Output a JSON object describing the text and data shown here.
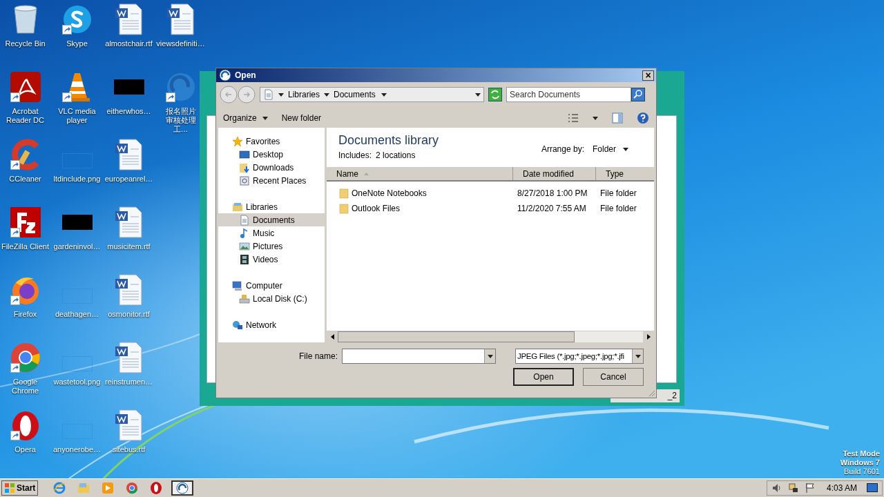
{
  "desktop": {
    "icon_columns": [
      [
        {
          "label": "Recycle Bin",
          "kind": "recycle",
          "shortcut": false
        },
        {
          "label": "Acrobat Reader DC",
          "kind": "acrobat",
          "shortcut": true
        },
        {
          "label": "CCleaner",
          "kind": "ccleaner",
          "shortcut": true
        },
        {
          "label": "FileZilla Client",
          "kind": "filezilla",
          "shortcut": true
        },
        {
          "label": "Firefox",
          "kind": "firefox",
          "shortcut": true
        },
        {
          "label": "Google Chrome",
          "kind": "chrome",
          "shortcut": true
        },
        {
          "label": "Opera",
          "kind": "opera",
          "shortcut": true
        }
      ],
      [
        {
          "label": "Skype",
          "kind": "skype",
          "shortcut": true
        },
        {
          "label": "VLC media player",
          "kind": "vlc",
          "shortcut": true
        },
        {
          "label": "ltdinclude.png",
          "kind": "blank",
          "shortcut": false
        },
        {
          "label": "gardeninvol…",
          "kind": "black",
          "shortcut": false
        },
        {
          "label": "deathagen…",
          "kind": "blank",
          "shortcut": false
        },
        {
          "label": "wastetool.png",
          "kind": "blank",
          "shortcut": false
        },
        {
          "label": "anyonerobe…",
          "kind": "blank",
          "shortcut": false
        }
      ],
      [
        {
          "label": "almostchair.rtf",
          "kind": "word",
          "shortcut": false
        },
        {
          "label": "eitherwhos…",
          "kind": "black",
          "shortcut": false
        },
        {
          "label": "europeanrel…",
          "kind": "word",
          "shortcut": false
        },
        {
          "label": "musicitem.rtf",
          "kind": "word",
          "shortcut": false
        },
        {
          "label": "osmonitor.rtf",
          "kind": "word",
          "shortcut": false
        },
        {
          "label": "reinstrumen…",
          "kind": "word",
          "shortcut": false
        },
        {
          "label": "sitebus.rtf",
          "kind": "word",
          "shortcut": false
        }
      ],
      [
        {
          "label": "viewsdefiniti…",
          "kind": "word",
          "shortcut": false
        },
        {
          "label": "报名照片审核处理工…",
          "kind": "swirl",
          "shortcut": true
        }
      ]
    ],
    "watermark_lines": [
      "Test Mode",
      "Windows 7",
      "Build 7601"
    ]
  },
  "background_window": {
    "text": "_2"
  },
  "dialog": {
    "title": "Open",
    "close": "×",
    "breadcrumbs": [
      "Libraries",
      "Documents"
    ],
    "search": {
      "placeholder": "Search Documents"
    },
    "toolbar": [
      "Organize",
      "New folder"
    ],
    "nav": [
      {
        "label": "Favorites",
        "kind": "star",
        "selected": false,
        "children": [
          {
            "label": "Desktop",
            "kind": "desktop",
            "selected": false
          },
          {
            "label": "Downloads",
            "kind": "downloads",
            "selected": false
          },
          {
            "label": "Recent Places",
            "kind": "recent",
            "selected": false
          }
        ]
      },
      {
        "label": "Libraries",
        "kind": "library",
        "selected": false,
        "children": [
          {
            "label": "Documents",
            "kind": "documents",
            "selected": true
          },
          {
            "label": "Music",
            "kind": "music",
            "selected": false
          },
          {
            "label": "Pictures",
            "kind": "pictures",
            "selected": false
          },
          {
            "label": "Videos",
            "kind": "videos",
            "selected": false
          }
        ]
      },
      {
        "label": "Computer",
        "kind": "computer",
        "selected": false,
        "children": [
          {
            "label": "Local Disk (C:)",
            "kind": "disk",
            "selected": false
          }
        ]
      },
      {
        "label": "Network",
        "kind": "network",
        "selected": false
      }
    ],
    "library_title": "Documents library",
    "includes_label": "Includes:",
    "includes_value": "2 locations",
    "arrange_label": "Arrange by:",
    "arrange_value": "Folder",
    "columns": [
      "Name",
      "Date modified",
      "Type"
    ],
    "rows": [
      {
        "name": "OneNote Notebooks",
        "date": "8/27/2018 1:00 PM",
        "type": "File folder"
      },
      {
        "name": "Outlook Files",
        "date": "11/2/2020 7:55 AM",
        "type": "File folder"
      }
    ],
    "file_name_label": "File name:",
    "filter": "JPEG Files (*.jpg;*.jpeg;*.jpg;*.jfi",
    "buttons": [
      "Open",
      "Cancel"
    ]
  },
  "taskbar": {
    "start": "Start",
    "apps": [
      {
        "kind": "ie",
        "selected": false
      },
      {
        "kind": "explorer",
        "selected": false
      },
      {
        "kind": "media",
        "selected": false
      },
      {
        "kind": "chrome",
        "selected": false
      },
      {
        "kind": "opera",
        "selected": false
      },
      {
        "kind": "swirl",
        "selected": true
      }
    ],
    "clock": "4:03 AM"
  }
}
